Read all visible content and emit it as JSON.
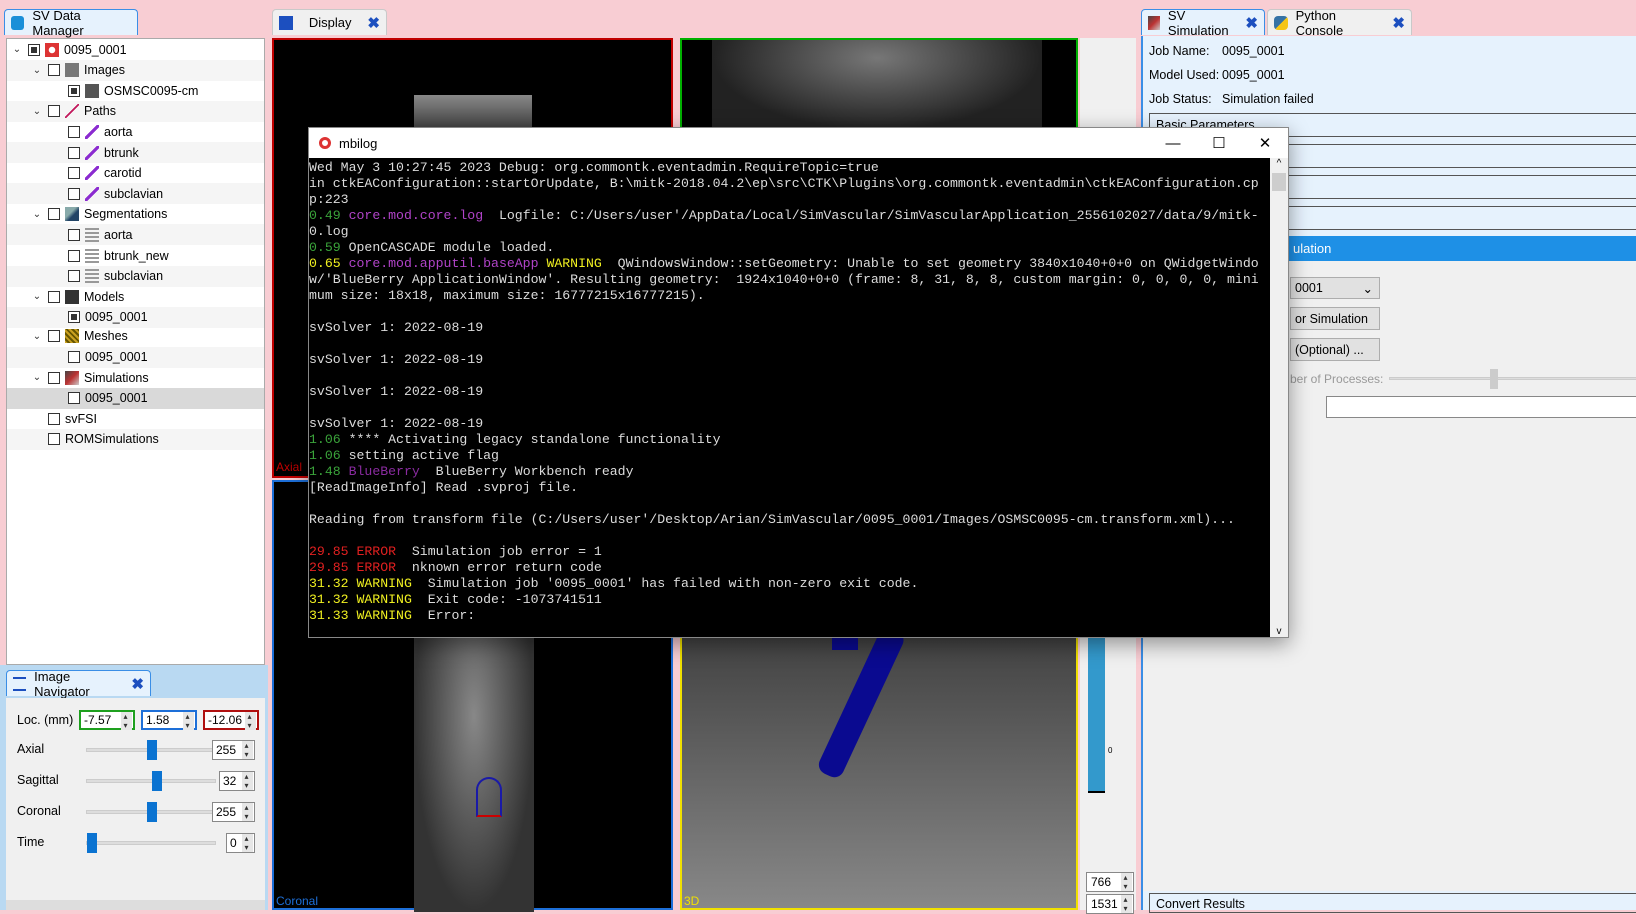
{
  "data_manager": {
    "tab": "SV Data Manager",
    "tree": [
      {
        "label": "0095_0001",
        "level": 0,
        "chev": true,
        "icon": "sv-logo-icon"
      },
      {
        "label": "Images",
        "level": 1,
        "chev": true,
        "icon": "images-icon"
      },
      {
        "label": "OSMSC0095-cm",
        "level": 2,
        "chev": false,
        "icon": "image-icon"
      },
      {
        "label": "Paths",
        "level": 1,
        "chev": true,
        "icon": "paths-icon"
      },
      {
        "label": "aorta",
        "level": 2,
        "chev": false,
        "icon": "path-icon"
      },
      {
        "label": "btrunk",
        "level": 2,
        "chev": false,
        "icon": "path-icon"
      },
      {
        "label": "carotid",
        "level": 2,
        "chev": false,
        "icon": "path-icon"
      },
      {
        "label": "subclavian",
        "level": 2,
        "chev": false,
        "icon": "path-icon"
      },
      {
        "label": "Segmentations",
        "level": 1,
        "chev": true,
        "icon": "segmentations-icon"
      },
      {
        "label": "aorta",
        "level": 2,
        "chev": false,
        "icon": "segmentation-icon"
      },
      {
        "label": "btrunk_new",
        "level": 2,
        "chev": false,
        "icon": "segmentation-icon"
      },
      {
        "label": "subclavian",
        "level": 2,
        "chev": false,
        "icon": "segmentation-icon"
      },
      {
        "label": "Models",
        "level": 1,
        "chev": true,
        "icon": "models-icon"
      },
      {
        "label": "0095_0001",
        "level": 2,
        "chev": false,
        "icon": "none"
      },
      {
        "label": "Meshes",
        "level": 1,
        "chev": true,
        "icon": "meshes-icon"
      },
      {
        "label": "0095_0001",
        "level": 2,
        "chev": false,
        "icon": "none"
      },
      {
        "label": "Simulations",
        "level": 1,
        "chev": true,
        "icon": "simulations-icon"
      },
      {
        "label": "0095_0001",
        "level": 2,
        "chev": false,
        "icon": "none",
        "selected": true
      },
      {
        "label": "svFSI",
        "level": 1,
        "chev": false,
        "icon": "none"
      },
      {
        "label": "ROMSimulations",
        "level": 1,
        "chev": false,
        "icon": "none"
      }
    ]
  },
  "navigator": {
    "tab": "Image Navigator",
    "loc_label": "Loc. (mm)",
    "loc": [
      "-7.57",
      "1.58",
      "-12.06"
    ],
    "sliders": [
      {
        "label": "Axial",
        "value": "255",
        "fraction": 0.5
      },
      {
        "label": "Sagittal",
        "value": "32",
        "fraction": 0.54
      },
      {
        "label": "Coronal",
        "value": "255",
        "fraction": 0.5
      },
      {
        "label": "Time",
        "value": "0",
        "fraction": 0
      }
    ]
  },
  "display": {
    "tab": "Display",
    "axial_label": "Axial",
    "coronal_label": "Coronal",
    "threed_label": "3D",
    "colorbar_zero": "0",
    "level": "766",
    "window": "1531"
  },
  "colors": {
    "axial": "#c00000",
    "sagittal": "#00b000",
    "coronal": "#1d6fd8",
    "threed": "#f0e000",
    "accent": "#1e90e6"
  },
  "log": {
    "title": "mbilog",
    "lines": [
      [
        [
          "",
          "Wed May 3 10:27:45 2023 Debug: org.commontk.eventadmin.RequireTopic=true"
        ]
      ],
      [
        [
          "",
          "in ctkEAConfiguration::startOrUpdate, B:\\mitk-2018.04.2\\ep\\src\\CTK\\Plugins\\org.commontk.eventadmin\\ctkEAConfiguration.cp"
        ]
      ],
      [
        [
          "",
          "p:223"
        ]
      ],
      [
        [
          "g",
          "0.49 "
        ],
        [
          "m",
          "core.mod.core.log"
        ],
        [
          "",
          "  Logfile: C:/Users/user'/AppData/Local/SimVascular/SimVascularApplication_2556102027/data/9/mitk-"
        ]
      ],
      [
        [
          "",
          "0.log"
        ]
      ],
      [
        [
          "g",
          "0.59 "
        ],
        [
          "",
          "OpenCASCADE module loaded."
        ]
      ],
      [
        [
          "y",
          "0.65 "
        ],
        [
          "m",
          "core.mod.apputil.baseApp "
        ],
        [
          "y",
          "WARNING"
        ],
        [
          "",
          "  QWindowsWindow::setGeometry: Unable to set geometry 3840x1040+0+0 on QWidgetWindo"
        ]
      ],
      [
        [
          "",
          "w/'BlueBerry ApplicationWindow'. Resulting geometry:  1924x1040+0+0 (frame: 8, 31, 8, 8, custom margin: 0, 0, 0, 0, mini"
        ]
      ],
      [
        [
          "",
          "mum size: 18x18, maximum size: 16777215x16777215)."
        ]
      ],
      [
        [
          "",
          ""
        ]
      ],
      [
        [
          "",
          "svSolver 1: 2022-08-19"
        ]
      ],
      [
        [
          "",
          ""
        ]
      ],
      [
        [
          "",
          "svSolver 1: 2022-08-19"
        ]
      ],
      [
        [
          "",
          ""
        ]
      ],
      [
        [
          "",
          "svSolver 1: 2022-08-19"
        ]
      ],
      [
        [
          "",
          ""
        ]
      ],
      [
        [
          "",
          "svSolver 1: 2022-08-19"
        ]
      ],
      [
        [
          "g",
          "1.06 "
        ],
        [
          "",
          "**** Activating legacy standalone functionality"
        ]
      ],
      [
        [
          "g",
          "1.06 "
        ],
        [
          "",
          "setting active flag"
        ]
      ],
      [
        [
          "g",
          "1.48 "
        ],
        [
          "p",
          "BlueBerry"
        ],
        [
          "",
          "  BlueBerry Workbench ready"
        ]
      ],
      [
        [
          "",
          "[ReadImageInfo] Read .svproj file."
        ]
      ],
      [
        [
          "",
          ""
        ]
      ],
      [
        [
          "",
          "Reading from transform file (C:/Users/user'/Desktop/Arian/SimVascular/0095_0001/Images/OSMSC0095-cm.transform.xml)..."
        ]
      ],
      [
        [
          "",
          ""
        ]
      ],
      [
        [
          "r",
          "29.85 ERROR"
        ],
        [
          "",
          "  Simulation job error = 1"
        ]
      ],
      [
        [
          "r",
          "29.85 ERROR"
        ],
        [
          "",
          "  nknown error return code"
        ]
      ],
      [
        [
          "y",
          "31.32 WARNING"
        ],
        [
          "",
          "  Simulation job '0095_0001' has failed with non-zero exit code."
        ]
      ],
      [
        [
          "y",
          "31.32 WARNING"
        ],
        [
          "",
          "  Exit code: -1073741511"
        ]
      ],
      [
        [
          "y",
          "31.33 WARNING"
        ],
        [
          "",
          "  Error:"
        ]
      ]
    ]
  },
  "simulation": {
    "tab": "SV Simulation",
    "python_tab": "Python Console",
    "job_name_label": "Job Name:",
    "job_name": "0095_0001",
    "model_label": "Model Used:",
    "model": "0095_0001",
    "status_label": "Job Status:",
    "status": "Simulation failed",
    "basic_params": "Basic Parameters",
    "run_header": "ulation",
    "combo": "0001",
    "create_btn": "or Simulation",
    "optional_btn": "(Optional) ...",
    "procs_label": "ber of Processes:",
    "procs_fraction": 0.5,
    "convert": "Convert Results"
  }
}
